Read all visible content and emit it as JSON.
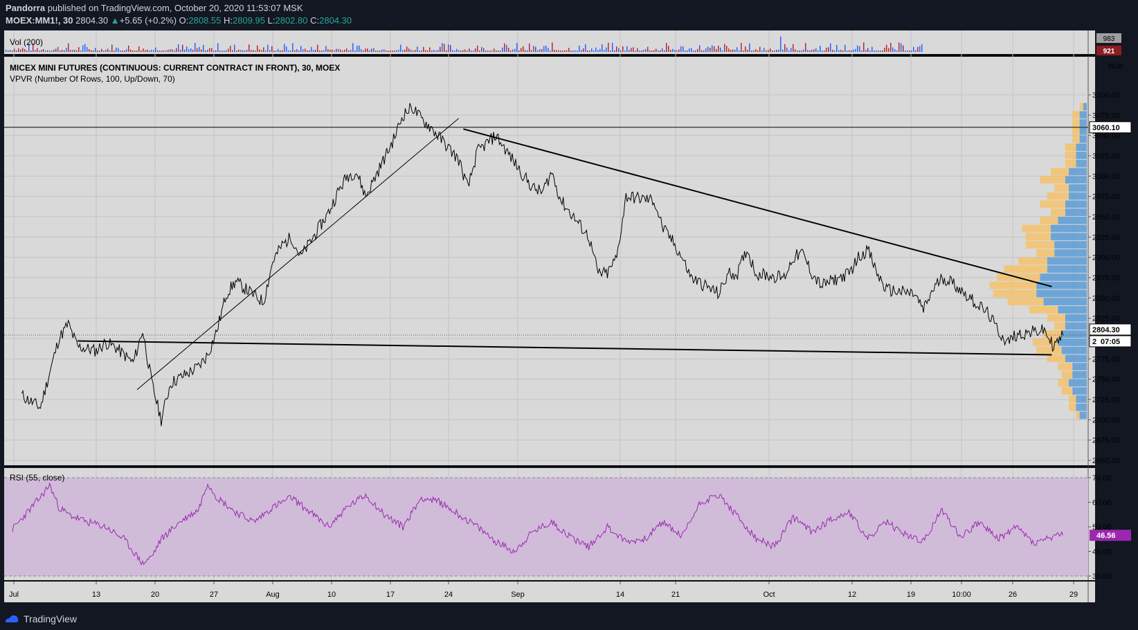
{
  "header": {
    "author": "Pandorra",
    "published": "published on TradingView.com, October 20, 2020 11:53:07 MSK",
    "symbol": "MOEX:MM1!, 30",
    "last": "2804.30",
    "change": "+5.65 (+0.2%)",
    "o_label": "O:",
    "o": "2808.55",
    "h_label": "H:",
    "h": "2809.95",
    "l_label": "L:",
    "l": "2802.80",
    "c_label": "C:",
    "c": "2804.30"
  },
  "footer": {
    "brand": "TradingView"
  },
  "colors": {
    "background": "#131722",
    "panel": "#d9d9d9",
    "candle": "#000000",
    "vp_up": "#5b9bd5",
    "vp_down": "#f4c26b",
    "rsi": "#9c27b0",
    "rsi_band": "#d0bcd9",
    "vol_up": "#2962ff",
    "vol_down": "#b22833"
  },
  "chart_data": [
    {
      "type": "line",
      "title": "MICEX MINI FUTURES (CONTINUOUS: CURRENT CONTRACT IN FRONT), 30, MOEX",
      "indicator_label": "VPVR (Number Of Rows, 100, Up/Down, 70)",
      "currency_label": "RUB",
      "x_ticks": [
        "Jul",
        "13",
        "20",
        "27",
        "Aug",
        "10",
        "17",
        "24",
        "Sep",
        "14",
        "21",
        "Oct",
        "12",
        "19",
        "10:00",
        "26",
        "29"
      ],
      "y_ticks": [
        2650,
        2675,
        2700,
        2725,
        2750,
        2775,
        2800,
        2825,
        2850,
        2875,
        2900,
        2925,
        2950,
        2975,
        3000,
        3025,
        3050,
        3075,
        3100
      ],
      "y_tick_labels": [
        "2650.00",
        "2675.00",
        "2700.00",
        "2725.00",
        "2750.00",
        "2775.00",
        "2800.00",
        "2825.00",
        "2850.00",
        "2875.00",
        "2900.00",
        "2925.00",
        "2950.00",
        "2975.00",
        "3000.00",
        "3025.00",
        "3050.00",
        "3075.00",
        "3100.00"
      ],
      "ylim": [
        2640,
        3125
      ],
      "x": [
        1,
        3,
        4,
        5,
        6,
        7,
        9,
        10,
        11,
        13,
        14,
        15,
        16,
        17,
        20,
        21,
        22,
        23,
        24,
        27,
        28,
        29,
        30,
        31,
        34,
        35,
        36,
        37,
        38,
        41,
        42,
        43,
        44,
        45,
        48,
        49,
        50,
        51,
        52,
        55,
        56,
        57,
        58,
        59,
        62,
        63,
        64,
        65,
        66,
        69,
        70,
        71,
        72,
        73,
        76,
        77,
        78,
        79,
        80,
        83,
        84,
        85,
        86,
        87,
        90,
        91,
        92,
        93,
        94,
        97,
        98,
        99,
        100,
        101,
        104,
        105,
        106,
        107,
        108,
        111,
        112,
        113
      ],
      "series": [
        {
          "values": [
            2730,
            2715,
            2758,
            2800,
            2818,
            2790,
            2785,
            2795,
            2790,
            2770,
            2810,
            2745,
            2700,
            2745,
            2765,
            2780,
            2810,
            2855,
            2870,
            2845,
            2895,
            2915,
            2925,
            2900,
            2955,
            2980,
            3000,
            3005,
            2975,
            3045,
            3075,
            3085,
            3070,
            3060,
            3020,
            2985,
            3030,
            3040,
            3050,
            3000,
            2985,
            2980,
            3005,
            2970,
            2925,
            2880,
            2880,
            2900,
            2975,
            2970,
            2935,
            2920,
            2900,
            2875,
            2855,
            2880,
            2880,
            2910,
            2880,
            2875,
            2900,
            2905,
            2880,
            2865,
            2880,
            2900,
            2910,
            2880,
            2860,
            2855,
            2835,
            2860,
            2875,
            2870,
            2840,
            2830,
            2810,
            2795,
            2805,
            2810,
            2790,
            2804
          ]
        }
      ],
      "horizontal_line": 3060.1,
      "horizontal_line_label": "3060.10",
      "last_price_label": "2804.30",
      "last_price_partial": "2",
      "countdown_label": "07:05",
      "trendlines": [
        {
          "x1": 13.4,
          "y1": 2737,
          "x2": 48.0,
          "y2": 3071
        },
        {
          "x1": 48.5,
          "y1": 3058,
          "x2": 111.8,
          "y2": 2864
        },
        {
          "x1": 7.0,
          "y1": 2797,
          "x2": 111.8,
          "y2": 2780
        }
      ],
      "volume_profile": {
        "price_levels": [
          2705,
          2715,
          2725,
          2735,
          2745,
          2755,
          2765,
          2775,
          2785,
          2795,
          2805,
          2815,
          2825,
          2835,
          2845,
          2855,
          2865,
          2875,
          2885,
          2895,
          2905,
          2915,
          2925,
          2935,
          2945,
          2955,
          2965,
          2975,
          2985,
          2995,
          3005,
          3015,
          3025,
          3035,
          3045,
          3055,
          3065,
          3075,
          3085
        ],
        "up": [
          2,
          3,
          3,
          4,
          5,
          4,
          4,
          6,
          7,
          8,
          7,
          6,
          6,
          8,
          12,
          14,
          14,
          13,
          11,
          11,
          9,
          9,
          10,
          10,
          8,
          6,
          6,
          5,
          5,
          6,
          5,
          3,
          3,
          3,
          2,
          2,
          2,
          2,
          1
        ],
        "down": [
          1,
          2,
          2,
          3,
          3,
          3,
          4,
          5,
          7,
          7,
          5,
          3,
          5,
          8,
          10,
          12,
          13,
          12,
          12,
          8,
          5,
          8,
          7,
          8,
          5,
          4,
          7,
          6,
          4,
          7,
          5,
          3,
          3,
          3,
          2,
          2,
          2,
          2,
          1
        ]
      }
    },
    {
      "type": "bar",
      "title": "Vol (200)",
      "label_top": "983",
      "label_bottom": "921"
    },
    {
      "type": "line",
      "title": "RSI (55, close)",
      "y_ticks": [
        30,
        40,
        50,
        60,
        70
      ],
      "y_tick_labels": [
        "30.00",
        "40.00",
        "50.00",
        "60.00",
        "70.00"
      ],
      "ylim": [
        28,
        72
      ],
      "band": [
        30,
        70
      ],
      "x": [
        0,
        3,
        4,
        5,
        6,
        8,
        10,
        12,
        13,
        14,
        15,
        16,
        18,
        20,
        21,
        22,
        24,
        26,
        28,
        30,
        32,
        34,
        36,
        38,
        40,
        42,
        44,
        46,
        48,
        50,
        52,
        54,
        56,
        58,
        60,
        62,
        64,
        66,
        68,
        70,
        72,
        74,
        76,
        78,
        80,
        82,
        84,
        86,
        88,
        90,
        92,
        94,
        96,
        98,
        100,
        102,
        104,
        106,
        108,
        110,
        111,
        113
      ],
      "values": [
        49,
        62,
        67,
        58,
        55,
        52,
        50,
        45,
        40,
        35,
        38,
        45,
        52,
        57,
        68,
        62,
        56,
        52,
        58,
        62,
        56,
        50,
        58,
        63,
        55,
        50,
        62,
        60,
        55,
        50,
        44,
        40,
        48,
        52,
        46,
        42,
        50,
        44,
        45,
        52,
        46,
        60,
        63,
        54,
        45,
        42,
        54,
        48,
        53,
        56,
        45,
        52,
        47,
        44,
        57,
        46,
        52,
        45,
        50,
        43,
        45,
        46.56
      ],
      "last_value_label": "46.56"
    }
  ]
}
